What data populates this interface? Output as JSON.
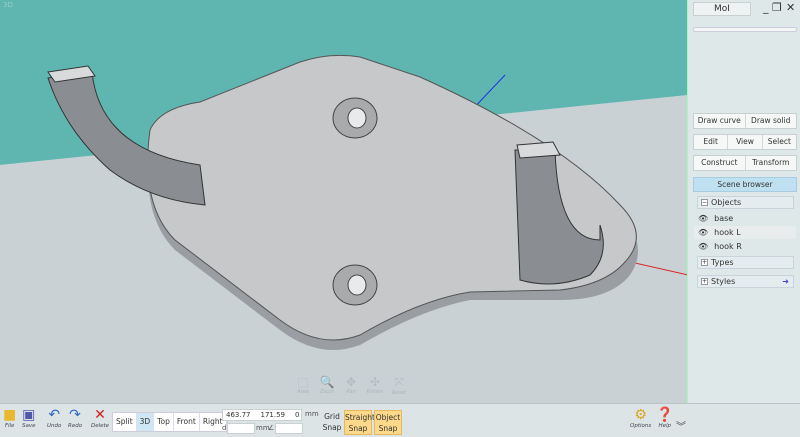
{
  "viewport": {
    "label": "3D",
    "nav": [
      {
        "icon": "area-icon",
        "label": "Area",
        "glyph": "⬚"
      },
      {
        "icon": "zoom-icon",
        "label": "Zoom",
        "glyph": "🔍"
      },
      {
        "icon": "pan-icon",
        "label": "Pan",
        "glyph": "✥"
      },
      {
        "icon": "rotate-icon",
        "label": "Rotate",
        "glyph": "✣"
      },
      {
        "icon": "reset-icon",
        "label": "Reset",
        "glyph": "⤧"
      }
    ]
  },
  "window": {
    "title": "MoI",
    "minimize": "_",
    "restore": "❐",
    "close": "✕"
  },
  "panel": {
    "draw_curve": "Draw curve",
    "draw_solid": "Draw solid",
    "edit": "Edit",
    "view": "View",
    "select": "Select",
    "construct": "Construct",
    "transform": "Transform",
    "scene_browser": "Scene browser",
    "objects": "Objects",
    "types": "Types",
    "styles": "Styles",
    "object_list": [
      "base",
      "hook L",
      "hook R"
    ]
  },
  "toolbar": {
    "file": "File",
    "save": "Save",
    "undo": "Undo",
    "redo": "Redo",
    "delete": "Delete",
    "views": [
      "Split",
      "3D",
      "Top",
      "Front",
      "Right"
    ],
    "active_view": "3D",
    "coords": {
      "x": "463.77",
      "y": "171.59",
      "z": "0"
    },
    "unit": "mm",
    "distance_label": "d",
    "distance": "",
    "angle_label": "∠",
    "angle": "",
    "grid_snap": [
      "Grid",
      "Snap"
    ],
    "straight_snap": [
      "Straight",
      "Snap"
    ],
    "object_snap": [
      "Object",
      "Snap"
    ],
    "options": "Options",
    "help": "Help",
    "expand": "︾"
  },
  "colors": {
    "sky": "#5fb6b1",
    "ground": "#c9d1d5",
    "accent_snap": "#fbd88a"
  }
}
